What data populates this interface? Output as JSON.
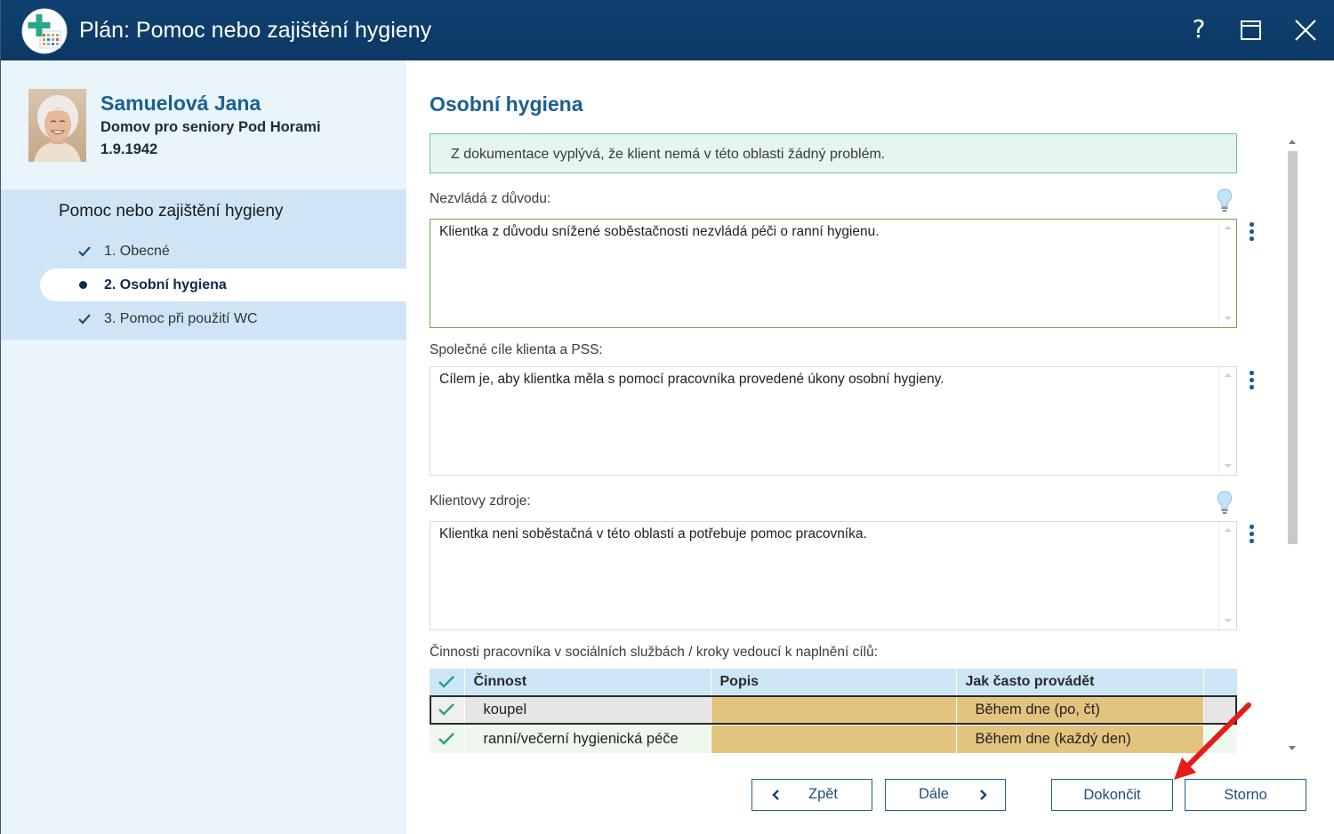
{
  "window": {
    "title": "Plán: Pomoc nebo zajištění hygieny",
    "help_label": "?"
  },
  "client": {
    "name": "Samuelová Jana",
    "facility": "Domov pro seniory Pod Horami",
    "birth_date": "1.9.1942"
  },
  "nav": {
    "section_title": "Pomoc nebo zajištění hygieny",
    "items": [
      {
        "label": "1. Obecné",
        "icon": "check-icon"
      },
      {
        "label": "2. Osobní hygiena",
        "icon": "bullet-icon"
      },
      {
        "label": "3. Pomoc při použití WC",
        "icon": "check-icon"
      }
    ]
  },
  "main": {
    "heading": "Osobní hygiena",
    "info": "Z dokumentace vyplývá, že klient nemá v této oblasti žádný problém.",
    "fields": [
      {
        "label": "Nezvládá z důvodu:",
        "value": "Klientka z důvodu snížené soběstačnosti nezvládá péči o ranní hygienu.",
        "has_hint": true,
        "focused": true
      },
      {
        "label": "Společné cíle klienta a PSS:",
        "value": "Cílem je, aby klientka měla s pomocí pracovníka provedené úkony osobní hygieny.",
        "has_hint": false,
        "focused": false
      },
      {
        "label": "Klientovy zdroje:",
        "value": "Klientka neni soběstačná v této oblasti a potřebuje pomoc pracovníka.",
        "has_hint": true,
        "focused": false
      }
    ],
    "activities": {
      "label": "Činnosti pracovníka v sociálních službách / kroky vedoucí k naplnění cílů:",
      "header_icon": "check-icon",
      "columns": [
        "Činnost",
        "Popis",
        "Jak často provádět"
      ],
      "rows": [
        {
          "activity": "koupel",
          "description": "",
          "frequency": "Během dne (po, čt)",
          "selected": true,
          "checked": true
        },
        {
          "activity": "ranní/večerní hygienická péče",
          "description": "",
          "frequency": "Během dne (každý den)",
          "selected": false,
          "checked": true
        }
      ]
    }
  },
  "buttons": {
    "back": "Zpět",
    "next": "Dále",
    "finish": "Dokončit",
    "cancel": "Storno"
  },
  "icons": {
    "app": "app-logo-icon",
    "help": "question-mark-icon",
    "maximize": "maximize-icon",
    "close": "close-icon",
    "hint": "lightbulb-icon",
    "field_menu": "more-vertical-icon",
    "back": "chevron-left-icon",
    "next": "chevron-right-icon",
    "annotation": "red-arrow-icon"
  },
  "colors": {
    "title_bar": "#0e3e6c",
    "accent": "#1c5f90",
    "sidebar_bg": "#e9f4fb",
    "nav_bg": "#cfe5f5",
    "focus_border": "#6aab47",
    "info_bg": "#e5f5f1",
    "info_border": "#6cc2b0",
    "table_header_bg": "#cde6f5",
    "cell_tan": "#e3c47f",
    "check_teal": "#2e9e7e",
    "annotation_red": "#e31c1c"
  }
}
